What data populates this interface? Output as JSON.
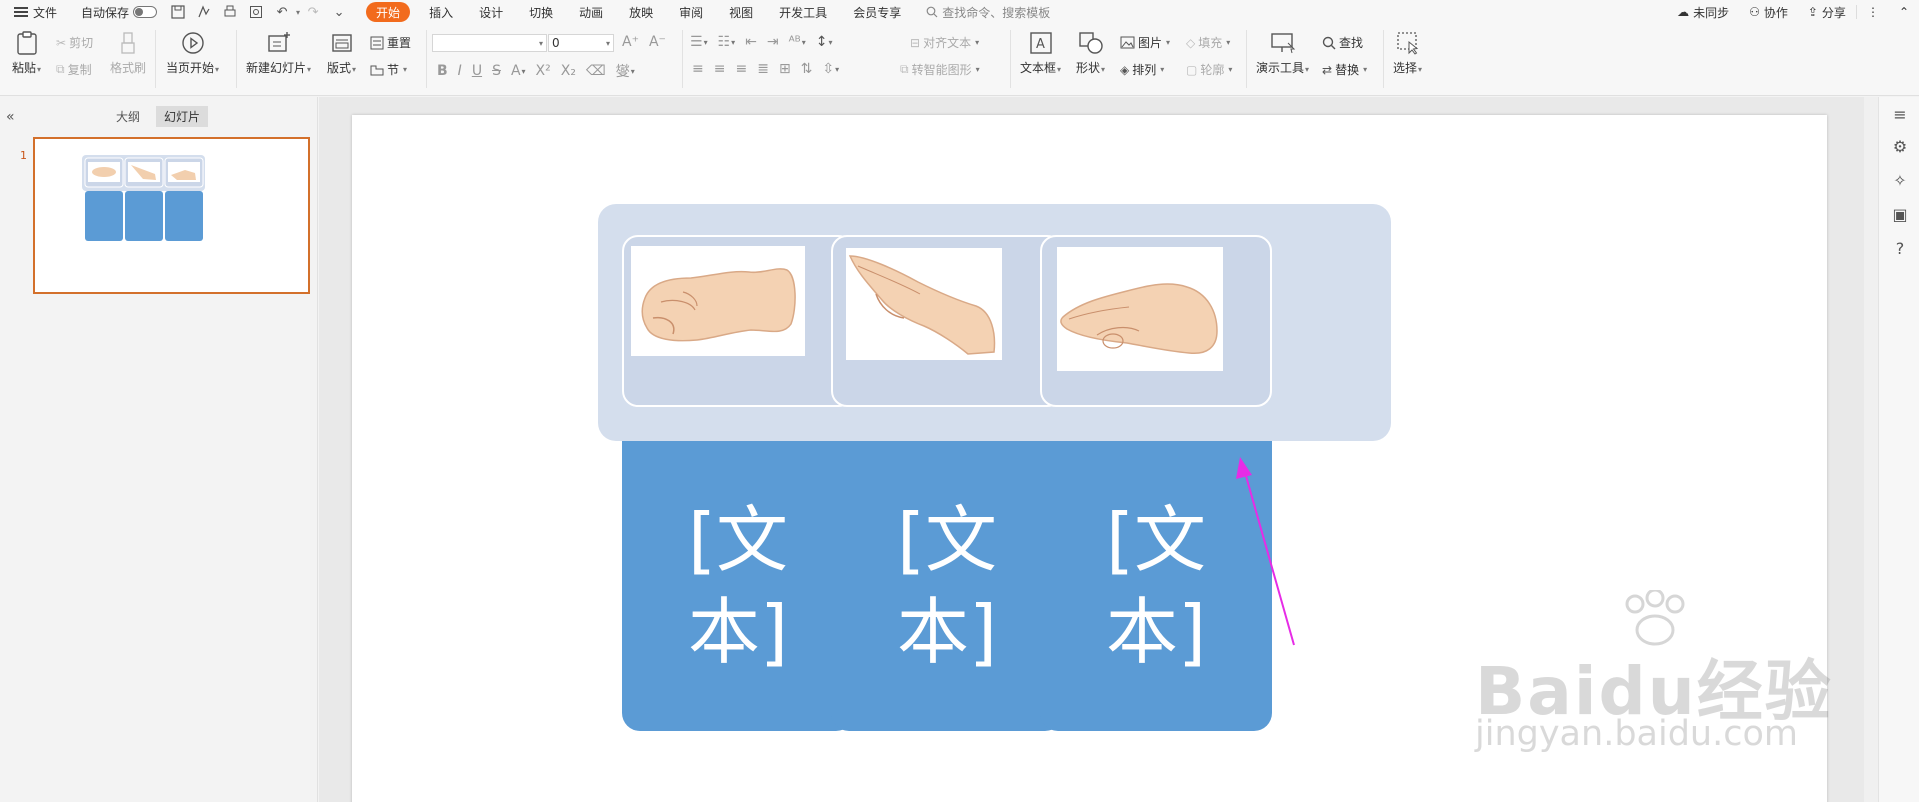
{
  "menubar": {
    "file": "文件",
    "autosave": "自动保存",
    "tabs": [
      "开始",
      "插入",
      "设计",
      "切换",
      "动画",
      "放映",
      "审阅",
      "视图",
      "开发工具",
      "会员专享"
    ],
    "search_placeholder": "查找命令、搜索模板",
    "sync": "未同步",
    "collab": "协作",
    "share": "分享"
  },
  "ribbon": {
    "paste": "粘贴",
    "cut": "剪切",
    "copy": "复制",
    "format_painter": "格式刷",
    "from_current": "当页开始",
    "new_slide": "新建幻灯片",
    "layout": "版式",
    "reset": "重置",
    "section": "节",
    "font_name": "",
    "font_size": "0",
    "align_text": "对齐文本",
    "to_smartart": "转智能图形",
    "textbox": "文本框",
    "shapes": "形状",
    "picture": "图片",
    "fill": "填充",
    "arrange": "排列",
    "outline": "轮廓",
    "presentation_tools": "演示工具",
    "find": "查找",
    "replace": "替换",
    "select": "选择"
  },
  "leftpanel": {
    "outline_tab": "大纲",
    "slides_tab": "幻灯片",
    "slide_number": "1"
  },
  "slide": {
    "cards": [
      {
        "text": "[文\n本]"
      },
      {
        "text": "[文\n本]"
      },
      {
        "text": "[文\n本]"
      }
    ],
    "card_color": "#5b9bd5",
    "frame_color": "#d4deed",
    "arrow_color": "#e62ce6"
  },
  "watermark": {
    "brand": "Baidu经验",
    "url": "jingyan.baidu.com"
  }
}
